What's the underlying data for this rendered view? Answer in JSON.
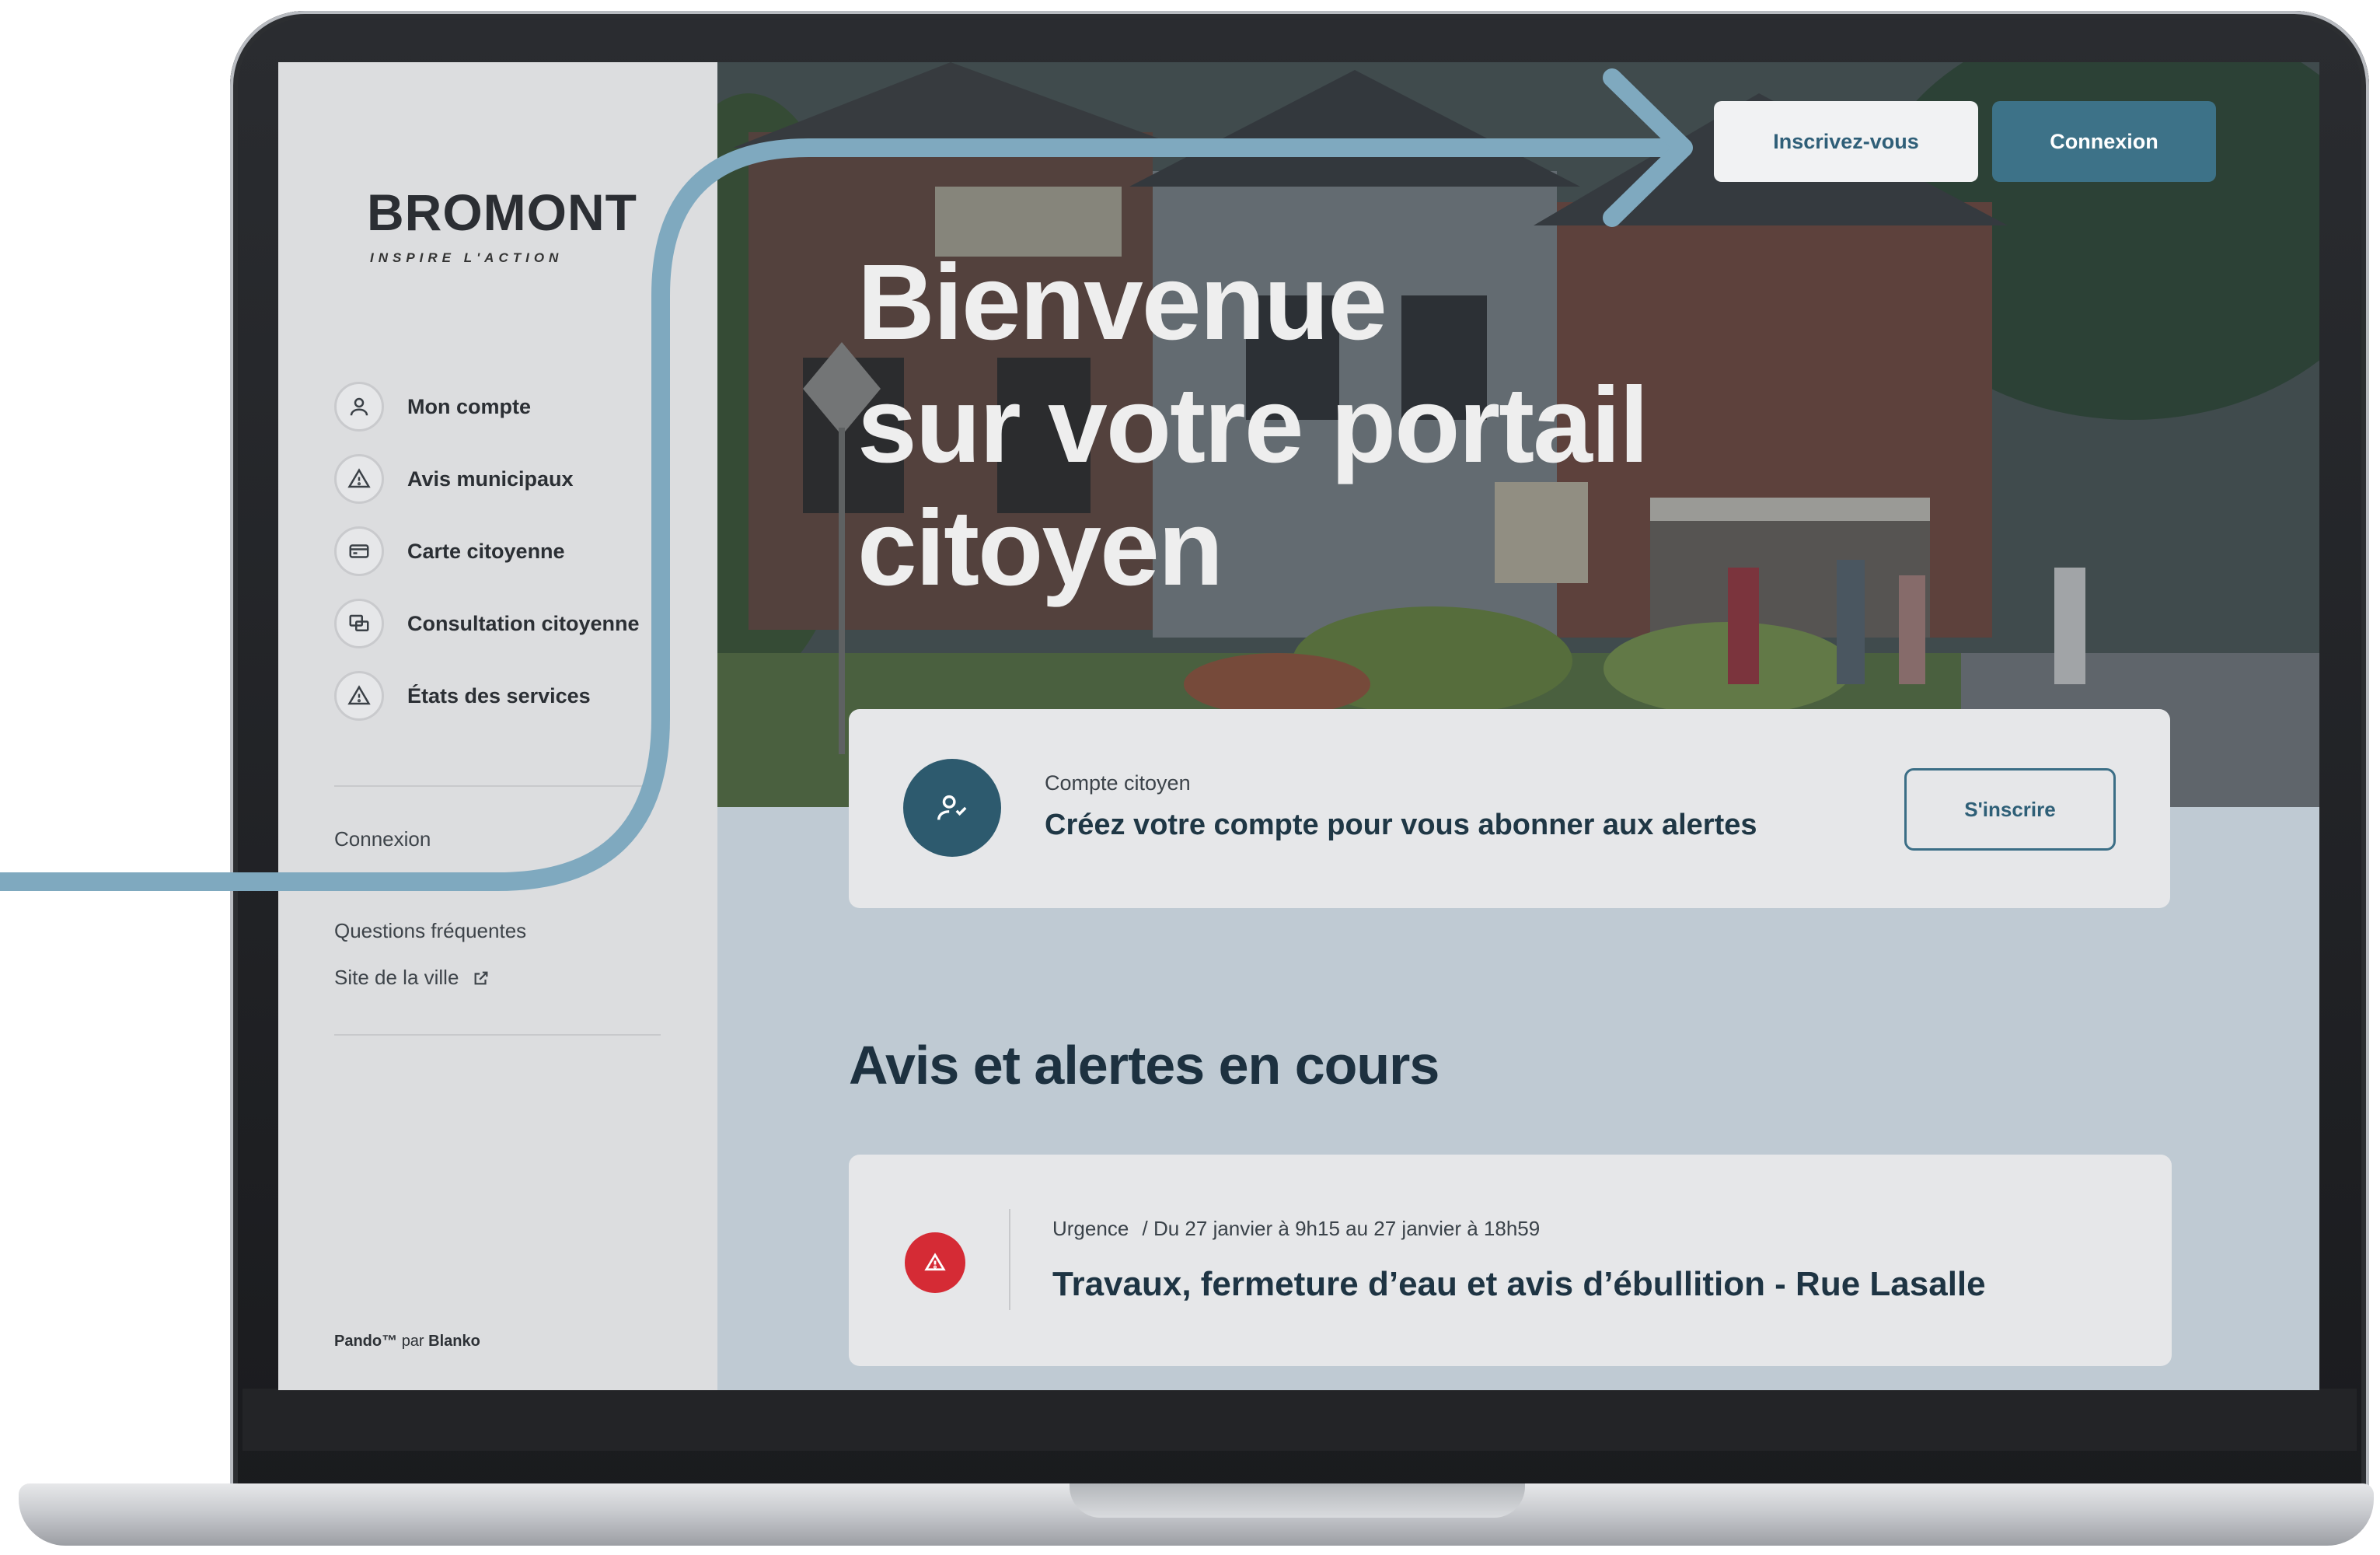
{
  "brand": {
    "logo_text": "BROMONT",
    "tagline": "INSPIRE L'ACTION"
  },
  "sidebar": {
    "items": [
      {
        "label": "Mon compte",
        "icon": "user-icon"
      },
      {
        "label": "Avis municipaux",
        "icon": "warning-icon"
      },
      {
        "label": "Carte citoyenne",
        "icon": "card-icon"
      },
      {
        "label": "Consultation citoyenne",
        "icon": "chat-icon"
      },
      {
        "label": "États des services",
        "icon": "warning-icon"
      }
    ],
    "login_link": "Connexion",
    "faq_link": "Questions fréquentes",
    "city_site_link": "Site de la ville",
    "powered_by": {
      "product": "Pando™",
      "by": "par",
      "company": "Blanko"
    }
  },
  "header": {
    "register_button": "Inscrivez-vous",
    "login_button": "Connexion"
  },
  "hero": {
    "title_line1": "Bienvenue",
    "title_line2": "sur votre portail",
    "title_line3": "citoyen"
  },
  "account_card": {
    "eyebrow": "Compte citoyen",
    "title": "Créez votre compte pour vous abonner aux alertes",
    "button": "S'inscrire"
  },
  "alerts_section": {
    "title": "Avis et alertes en cours",
    "items": [
      {
        "category": "Urgence",
        "dates": "/ Du 27 janvier à 9h15 au 27 janvier à 18h59",
        "title": "Travaux, fermeture d’eau et avis d’ébullition  - Rue Lasalle"
      }
    ]
  },
  "colors": {
    "accent": "#3d7288",
    "deco_arrow": "#7fa9bf",
    "alert": "#d52b35",
    "content_bg": "#bfcad3"
  }
}
